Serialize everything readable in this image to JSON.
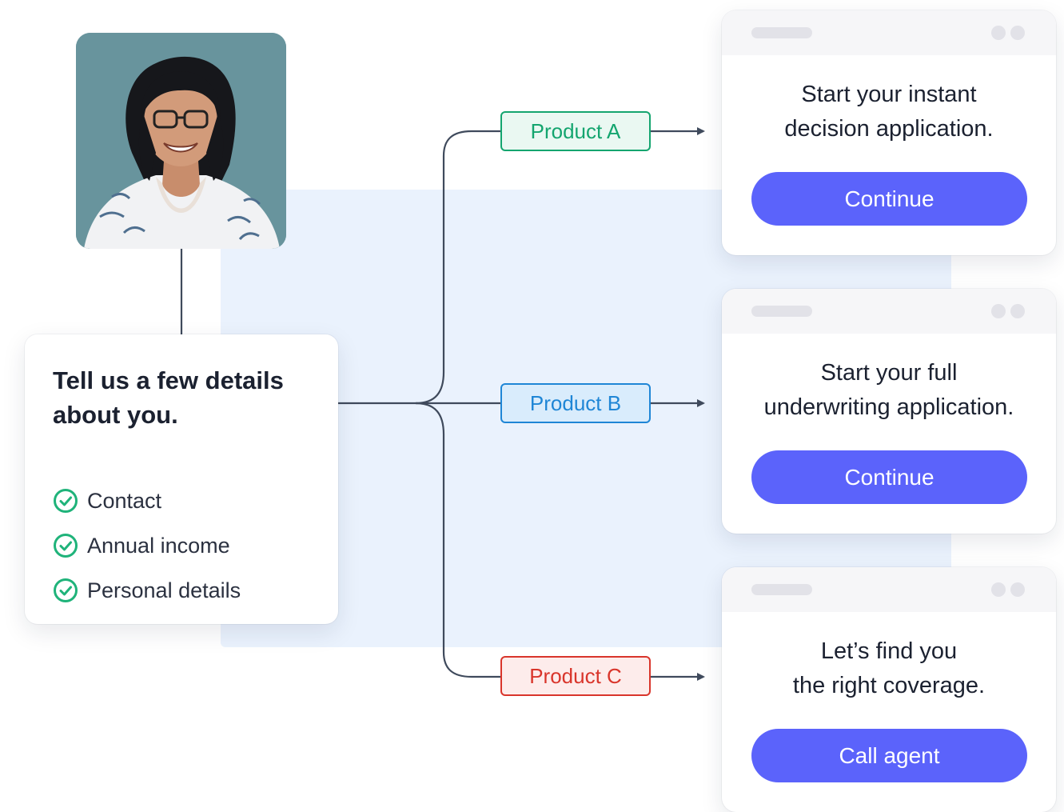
{
  "details": {
    "title_line1": "Tell us a few details",
    "title_line2": "about you.",
    "checklist": [
      "Contact",
      "Annual income",
      "Personal details"
    ],
    "check_color": "#1fb37a"
  },
  "products": [
    {
      "label": "Product A",
      "color": "#14a56f",
      "fill": "#eaf8f2"
    },
    {
      "label": "Product B",
      "color": "#1f86d6",
      "fill": "#d9ecfc"
    },
    {
      "label": "Product C",
      "color": "#d9352b",
      "fill": "#fdeceb"
    }
  ],
  "cards": [
    {
      "line1": "Start your instant",
      "line2": "decision application.",
      "button": "Continue"
    },
    {
      "line1": "Start your full",
      "line2": "underwriting application.",
      "button": "Continue"
    },
    {
      "line1": "Let’s find you",
      "line2": "the right coverage.",
      "button": "Call agent"
    }
  ],
  "colors": {
    "button": "#5b63fb",
    "connector": "#3f4a5c",
    "panel": "#eaf2fd"
  }
}
